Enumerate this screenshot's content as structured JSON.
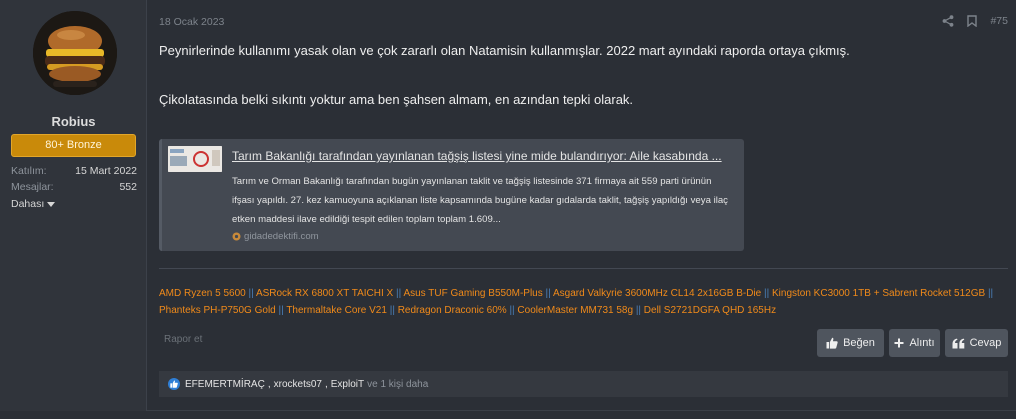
{
  "user": {
    "username": "Robius",
    "rank": "80+ Bronze",
    "joined_label": "Katılım:",
    "joined_value": "15 Mart 2022",
    "messages_label": "Mesajlar:",
    "messages_value": "552",
    "more_label": "Dahası"
  },
  "post": {
    "date": "18 Ocak 2023",
    "number": "#75",
    "paragraph_1": "Peynirlerinde kullanımı yasak olan ve çok zararlı olan Natamisin kullanmışlar. 2022 mart ayındaki raporda ortaya çıkmış.",
    "paragraph_2": "Çikolatasında belki sıkıntı yoktur ama ben şahsen almam, en azından tepki olarak."
  },
  "embed": {
    "title": "Tarım Bakanlığı tarafından yayınlanan tağşiş listesi yine mide bulandırıyor: Aile kasabında ...",
    "description": "Tarım ve Orman Bakanlığı tarafından bugün yayınlanan taklit ve tağşiş listesinde 371 firmaya ait 559 parti ürünün ifşası yapıldı. 27. kez kamuoyuna açıklanan liste kapsamında bugüne kadar gıdalarda taklit, tağşiş yapıldığı veya ilaç etken maddesi ilave edildiği tespit edilen toplam toplam 1.609...",
    "source": "gidadedektifi.com"
  },
  "signature": {
    "items": [
      "AMD Ryzen 5 5600",
      "ASRock RX 6800 XT TAICHI X",
      "Asus TUF Gaming B550M-Plus",
      "Asgard Valkyrie 3600MHz CL14 2x16GB B-Die",
      "Kingston KC3000 1TB + Sabrent Rocket 512GB",
      "Phanteks PH-P750G Gold",
      "Thermaltake Core V21",
      "Redragon Draconic 60%",
      "CoolerMaster MM731 58g",
      "Dell S2721DGFA QHD 165Hz"
    ],
    "separator": "||"
  },
  "actions": {
    "report": "Rapor et",
    "like": "Beğen",
    "quote": "Alıntı",
    "reply": "Cevap"
  },
  "likes": {
    "users": [
      "EFEMERTMİRAÇ",
      "xrockets07",
      "ExploiT"
    ],
    "suffix": "ve 1 kişi daha"
  },
  "colors": {
    "background": "#2b2f36",
    "rank_badge": "#c98a0a",
    "signature_text": "#f08a1a",
    "signature_separator": "#4a7fb8",
    "like_icon": "#2f7fd6"
  },
  "icons": [
    "share-icon",
    "bookmark-icon",
    "caret-down-icon",
    "thumbs-up-icon",
    "plus-icon",
    "quote-icon",
    "like-reaction-icon",
    "site-favicon"
  ]
}
